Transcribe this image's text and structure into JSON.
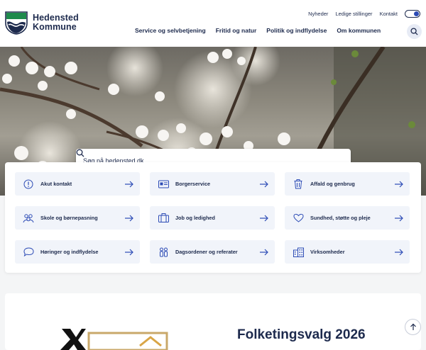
{
  "brand": {
    "name_line1": "Hedensted",
    "name_line2": "Kommune"
  },
  "util_links": [
    "Nyheder",
    "Ledige stillinger",
    "Kontakt"
  ],
  "nav_items": [
    "Service og selvbetjening",
    "Fritid og natur",
    "Politik og indflydelse",
    "Om kommunen"
  ],
  "search": {
    "placeholder": "Søg på hedensted.dk"
  },
  "tiles": [
    {
      "label": "Akut kontakt",
      "icon": "alert-circle-icon"
    },
    {
      "label": "Borgerservice",
      "icon": "id-card-icon"
    },
    {
      "label": "Affald og genbrug",
      "icon": "trash-icon"
    },
    {
      "label": "Skole og børnepasning",
      "icon": "group-icon"
    },
    {
      "label": "Job og ledighed",
      "icon": "briefcase-icon"
    },
    {
      "label": "Sundhed, støtte og pleje",
      "icon": "heart-icon"
    },
    {
      "label": "Høringer og indflydelse",
      "icon": "speech-bubble-icon"
    },
    {
      "label": "Dagsordener og referater",
      "icon": "people-icon"
    },
    {
      "label": "Virksomheder",
      "icon": "building-icon"
    }
  ],
  "feature": {
    "title": "Folketingsvalg 2026"
  },
  "colors": {
    "navy": "#1d2a4d",
    "accent_blue": "#2c4bb5",
    "tile_bg": "#f1f4fa",
    "logo_green": "#1e8a4c"
  }
}
